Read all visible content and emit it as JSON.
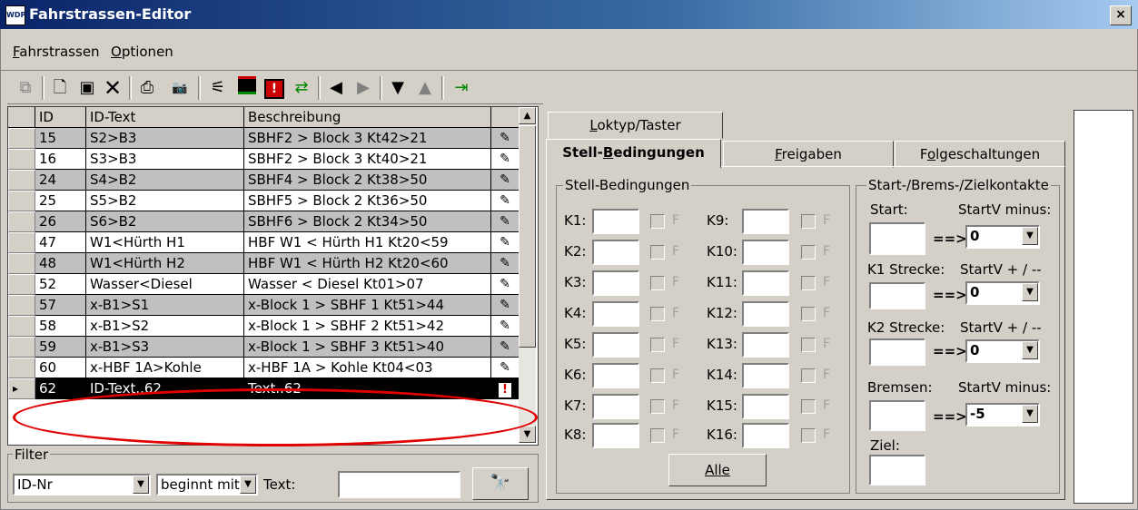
{
  "window": {
    "title": "Fahrstrassen-Editor",
    "icon": "app-icon",
    "close_label": "×"
  },
  "menu": [
    "Fahrstrassen",
    "Optionen"
  ],
  "toolbar_icons": [
    "route-icon",
    "new-icon",
    "save-icon",
    "delete-icon",
    "print-icon",
    "camera-icon",
    "signal-icon",
    "block-icon",
    "warning-icon",
    "swap-icon",
    "arrow-left-icon",
    "arrow-right-icon",
    "arrow-down-icon",
    "arrow-up-icon",
    "exit-icon"
  ],
  "table": {
    "headers": [
      "ID",
      "ID-Text",
      "Beschreibung",
      ""
    ],
    "rows": [
      {
        "id": "15",
        "text": "S2>B3",
        "desc": "SBHF2 > Block 3 Kt42>21",
        "shade": true
      },
      {
        "id": "16",
        "text": "S3>B3",
        "desc": "SBHF2 > Block 3 Kt40>21",
        "shade": false
      },
      {
        "id": "24",
        "text": "S4>B2",
        "desc": "SBHF4 > Block 2 Kt38>50",
        "shade": true
      },
      {
        "id": "25",
        "text": "S5>B2",
        "desc": "SBHF5 > Block 2 Kt36>50",
        "shade": false
      },
      {
        "id": "26",
        "text": "S6>B2",
        "desc": "SBHF6 > Block 2 Kt34>50",
        "shade": true
      },
      {
        "id": "47",
        "text": "W1<Hürth H1",
        "desc": "HBF W1 < Hürth H1 Kt20<59",
        "shade": false
      },
      {
        "id": "48",
        "text": "W1<Hürth H2",
        "desc": "HBF W1 < Hürth H2 Kt20<60",
        "shade": true
      },
      {
        "id": "52",
        "text": "Wasser<Diesel",
        "desc": "Wasser < Diesel Kt01>07",
        "shade": false
      },
      {
        "id": "57",
        "text": "x-B1>S1",
        "desc": "x-Block 1 > SBHF 1 Kt51>44",
        "shade": true
      },
      {
        "id": "58",
        "text": "x-B1>S2",
        "desc": "x-Block 1 > SBHF 2 Kt51>42",
        "shade": false
      },
      {
        "id": "59",
        "text": "x-B1>S3",
        "desc": "x-Block 1 > SBHF 3 Kt51>40",
        "shade": true
      },
      {
        "id": "60",
        "text": "x-HBF 1A>Kohle",
        "desc": "x-HBF 1A > Kohle Kt04<03",
        "shade": false
      },
      {
        "id": "62",
        "text": "ID-Text..62",
        "desc": "Text..62",
        "shade": false,
        "selected": true
      }
    ]
  },
  "filter": {
    "title": "Filter",
    "field": "ID-Nr",
    "mode": "beginnt mit",
    "text_label": "Text:",
    "text_value": ""
  },
  "tabs": {
    "row1": [
      "Loktyp/Taster"
    ],
    "row2": [
      "Stell-Bedingungen",
      "Freigaben",
      "Folgeschaltungen"
    ]
  },
  "stell": {
    "title": "Stell-Bedingungen",
    "left": [
      "K1:",
      "K2:",
      "K3:",
      "K4:",
      "K5:",
      "K6:",
      "K7:",
      "K8:"
    ],
    "right": [
      "K9:",
      "K10:",
      "K11:",
      "K12:",
      "K13:",
      "K14:",
      "K15:",
      "K16:"
    ],
    "f_label": "F",
    "all_button": "Alle"
  },
  "kontakte": {
    "title": "Start-/Brems-/Zielkontakte",
    "start": "Start:",
    "startv_minus": "StartV minus:",
    "k1": "K1 Strecke:",
    "startv_pm": "StartV + / --",
    "k2": "K2 Strecke:",
    "startv_pm2": "StartV + / --",
    "bremsen": "Bremsen:",
    "startv_minus2": "StartV minus:",
    "ziel": "Ziel:",
    "arrow": "==>",
    "values": [
      "0",
      "0",
      "0",
      "-5"
    ]
  }
}
